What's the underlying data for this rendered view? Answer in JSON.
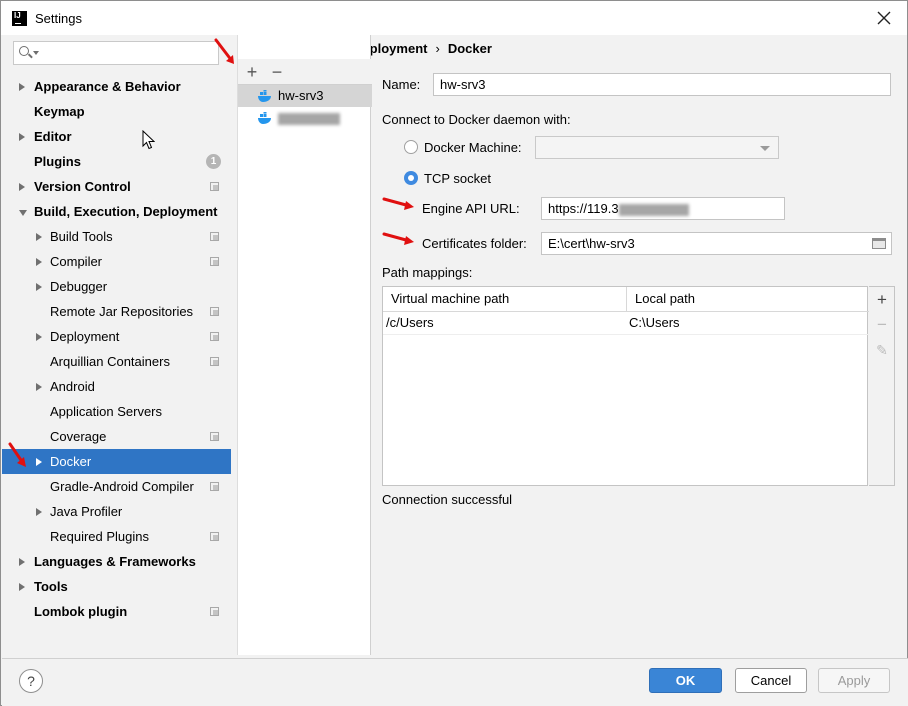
{
  "window": {
    "title": "Settings",
    "app_icon": "intellij-icon",
    "app_icon_text": "IJ"
  },
  "sidebar": {
    "search_placeholder": "",
    "items": [
      {
        "label": "Appearance & Behavior",
        "level": 0,
        "arrow": "right",
        "badge": null
      },
      {
        "label": "Keymap",
        "level": 0,
        "arrow": null,
        "badge": null
      },
      {
        "label": "Editor",
        "level": 0,
        "arrow": "right",
        "badge": null
      },
      {
        "label": "Plugins",
        "level": 0,
        "arrow": null,
        "badge": "1"
      },
      {
        "label": "Version Control",
        "level": 0,
        "arrow": "right",
        "badge": "project"
      },
      {
        "label": "Build, Execution, Deployment",
        "level": 0,
        "arrow": "down",
        "badge": null
      },
      {
        "label": "Build Tools",
        "level": 1,
        "arrow": "right",
        "badge": "project"
      },
      {
        "label": "Compiler",
        "level": 1,
        "arrow": "right",
        "badge": "project"
      },
      {
        "label": "Debugger",
        "level": 1,
        "arrow": "right",
        "badge": null
      },
      {
        "label": "Remote Jar Repositories",
        "level": 1,
        "arrow": null,
        "badge": "project"
      },
      {
        "label": "Deployment",
        "level": 1,
        "arrow": "right",
        "badge": "project"
      },
      {
        "label": "Arquillian Containers",
        "level": 1,
        "arrow": null,
        "badge": "project"
      },
      {
        "label": "Android",
        "level": 1,
        "arrow": "right",
        "badge": null
      },
      {
        "label": "Application Servers",
        "level": 1,
        "arrow": null,
        "badge": null
      },
      {
        "label": "Coverage",
        "level": 1,
        "arrow": null,
        "badge": "project"
      },
      {
        "label": "Docker",
        "level": 1,
        "arrow": "right",
        "badge": null,
        "selected": true
      },
      {
        "label": "Gradle-Android Compiler",
        "level": 1,
        "arrow": null,
        "badge": "project"
      },
      {
        "label": "Java Profiler",
        "level": 1,
        "arrow": "right",
        "badge": null
      },
      {
        "label": "Required Plugins",
        "level": 1,
        "arrow": null,
        "badge": "project"
      },
      {
        "label": "Languages & Frameworks",
        "level": 0,
        "arrow": "right",
        "badge": null
      },
      {
        "label": "Tools",
        "level": 0,
        "arrow": "right",
        "badge": null
      },
      {
        "label": "Lombok plugin",
        "level": 0,
        "arrow": null,
        "badge": "project"
      }
    ]
  },
  "breadcrumb": {
    "parent": "Build, Execution, Deployment",
    "separator": "›",
    "current": "Docker"
  },
  "servers_toolbar": {
    "add": "+",
    "remove": "−"
  },
  "servers": [
    {
      "name": "hw-srv3",
      "selected": true
    },
    {
      "name": "",
      "redacted": true
    }
  ],
  "form": {
    "name_label": "Name:",
    "name_value": "hw-srv3",
    "connect_label": "Connect to Docker daemon with:",
    "docker_machine_label": "Docker Machine:",
    "docker_machine_value": "",
    "tcp_socket_label": "TCP socket",
    "engine_api_label": "Engine API URL:",
    "engine_api_value": "https://119.3",
    "cert_folder_label": "Certificates folder:",
    "cert_folder_value": "E:\\cert\\hw-srv3",
    "path_mappings_label": "Path mappings:",
    "connection_status": "Connection successful"
  },
  "path_mappings": {
    "columns": [
      "Virtual machine path",
      "Local path"
    ],
    "rows": [
      [
        "/c/Users",
        "C:\\Users"
      ]
    ],
    "side_buttons": {
      "add": "+",
      "remove": "−",
      "edit": "✎"
    }
  },
  "footer": {
    "help": "?",
    "ok": "OK",
    "cancel": "Cancel",
    "apply": "Apply"
  },
  "colors": {
    "selection": "#2f75c5",
    "ok_button": "#3a85d6",
    "radio_checked": "#3f8ae0",
    "annotation_arrow": "#e01010"
  }
}
